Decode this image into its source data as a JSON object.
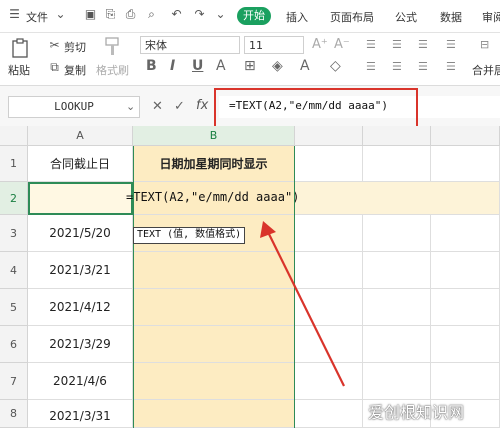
{
  "menubar": {
    "file_label": "文件",
    "tabs": [
      "开始",
      "插入",
      "页面布局",
      "公式",
      "数据",
      "审阅"
    ]
  },
  "ribbon": {
    "paste_label": "粘贴",
    "cut_label": "剪切",
    "copy_label": "复制",
    "format_painter_label": "格式刷",
    "font_name": "宋体",
    "font_size": "11",
    "merge_label": "合并居"
  },
  "formula_bar": {
    "name_box": "LOOKUP",
    "fx_label": "fx",
    "formula": "=TEXT(A2,\"e/mm/dd aaaa\")"
  },
  "sheet": {
    "columns": [
      "A",
      "B"
    ],
    "rows": [
      "1",
      "2",
      "3",
      "4",
      "5",
      "6",
      "7",
      "8"
    ],
    "a1": "合同截止日",
    "b1": "日期加星期同时显示",
    "editing_formula": "=TEXT(A2,\"e/mm/dd aaaa\")",
    "tooltip": "TEXT (值, 数值格式)",
    "dates": [
      "2021/5/20",
      "2021/3/21",
      "2021/4/12",
      "2021/3/29",
      "2021/4/6",
      "2021/3/31"
    ]
  },
  "watermark": "爱创根知识网",
  "colors": {
    "accent_green": "#1aa05f",
    "highlight_yellow": "#fdecc2",
    "annotation_red": "#d9342b"
  }
}
